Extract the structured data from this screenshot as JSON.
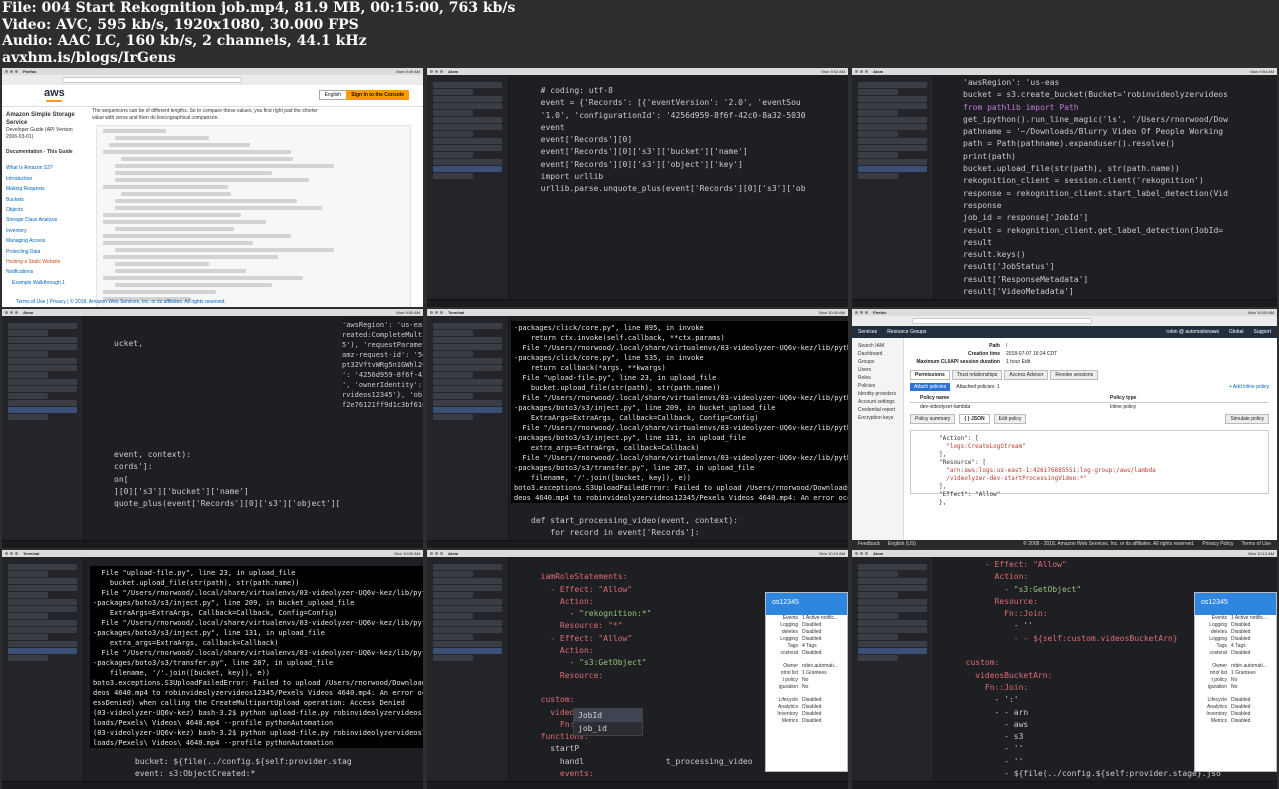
{
  "meta": {
    "file": "File: 004 Start Rekognition job.mp4, 81.9 MB, 00:15:00, 763 kb/s",
    "video": "Video: AVC, 595 kb/s, 1920x1080, 30.000 FPS",
    "audio": "Audio: AAC LC, 160 kb/s, 2 channels, 44.1 kHz",
    "site": "avxhm.is/blogs/IrGens"
  },
  "tile1": {
    "app": "Firefox",
    "clock": "Mon 9:49 AM",
    "docs": {
      "console_button": "Sign In to the Console",
      "language": "English",
      "service_title": "Amazon Simple Storage Service",
      "guide": "Developer Guide (API Version 2006-03-01)",
      "doc_title": "Documentation - This Guide",
      "nav": [
        "What Is Amazon S3?",
        "Introduction",
        "Making Requests",
        "Buckets",
        "Objects",
        "Storage Class Analysis",
        "Inventory",
        "Managing Access",
        "Protecting Data",
        "Hosting a Static Website",
        "Notifications"
      ],
      "nav_active": "Hosting a Static Website",
      "nav_sub": "Example Walkthrough 1",
      "body_line_1": "The sequencers can be of different lengths. So to compare these values, you first right pad the shorter",
      "body_line_2": "value with zeros and then do lexicographical comparison.",
      "footer": "Terms of Use | Privacy | © 2018, Amazon Web Services, Inc. or its affiliates. All rights reserved."
    }
  },
  "tile2": {
    "app": "Atom",
    "clock": "Mon 9:52 AM",
    "code": [
      "  # coding: utf-8",
      "  event = {'Records': [{'eventVersion': '2.0', 'eventSou",
      "  '1.0', 'configurationId': '4256d959-8f6f-42c0-8a32-5030",
      "  event",
      "  event['Records'][0]",
      "  event['Records'][0]['s3']['bucket']['name']",
      "  event['Records'][0]['s3']['object']['key']",
      "  import urllib",
      "  urllib.parse.unquote_plus(event['Records'][0]['s3']['ob"
    ]
  },
  "tile3": {
    "app": "Atom",
    "clock": "Mon 9:54 AM",
    "code": [
      "'awsRegion': 'us-eas",
      "bucket = s3.create_bucket(Bucket='robinvideolyzervideos",
      "from pathlib import Path",
      "get_ipython().run_line_magic('ls', '/Users/rnorwood/Dow",
      "pathname = '~/Downloads/Blurry Video Of People Working",
      "path = Path(pathname).expanduser().resolve()",
      "print(path)",
      "bucket.upload_file(str(path), str(path.name))",
      "rekognition_client = session.client('rekognition')",
      "response = rekognition_client.start_label_detection(Vid",
      "response",
      "job_id = response['JobId']",
      "result = rekognition_client.get_label_detection(JobId=",
      "result",
      "result.keys()",
      "result['JobStatus']",
      "result['ResponseMetadata']",
      "result['VideoMetadata']",
      "result['Labels']",
      "len(result['Labels'])"
    ]
  },
  "tile4": {
    "app": "Atom",
    "clock": "Mon 9:55 AM",
    "code": [
      "",
      "ucket,",
      "",
      "",
      "",
      "",
      "",
      "",
      "",
      "",
      "event, context):",
      "cords']:",
      "on[",
      "][0]['s3']['bucket']['name']",
      "quote_plus(event['Records'][0]['s3']['object']['key'])"
    ],
    "overlay": [
      "'awsRegion': 'us-eas",
      "reated:CompleteMultipa",
      "5'), 'requestParameter",
      "amz-request-id': '5C55",
      "pt32VftvWRg5n1GWhl2C",
      "': '4256d959-8f6f-42",
      "', 'ownerIdentity': {",
      "rvideos12345'}, 'objec",
      "f2e76121ff9d1c3bf616c4"
    ]
  },
  "tile5": {
    "app": "Terminal",
    "clock": "Mon 10:00 AM",
    "term": [
      "-packages/click/core.py\", line 895, in invoke",
      "    return ctx.invoke(self.callback, **ctx.params)",
      "  File \"/Users/rnorwood/.local/share/virtualenvs/03-videolyzer-UQ6v-kez/lib/python3.6/site",
      "-packages/click/core.py\", line 535, in invoke",
      "    return callback(*args, **kwargs)",
      "  File \"upload-file.py\", line 23, in upload_file",
      "    bucket.upload_file(str(path), str(path.name))",
      "  File \"/Users/rnorwood/.local/share/virtualenvs/03-videolyzer-UQ6v-kez/lib/python3.6/site",
      "-packages/boto3/s3/inject.py\", line 209, in bucket_upload_file",
      "    ExtraArgs=ExtraArgs, Callback=Callback, Config=Config)",
      "  File \"/Users/rnorwood/.local/share/virtualenvs/03-videolyzer-UQ6v-kez/lib/python3.6/site",
      "-packages/boto3/s3/inject.py\", line 131, in upload_file",
      "    extra_args=ExtraArgs, callback=Callback)",
      "  File \"/Users/rnorwood/.local/share/virtualenvs/03-videolyzer-UQ6v-kez/lib/python3.6/site",
      "-packages/boto3/s3/transfer.py\", line 287, in upload_file",
      "    filename, '/'.join([bucket, key]), e))",
      "boto3.exceptions.S3UploadFailedError: Failed to upload /Users/rnorwood/Downloads/Pexels Vi",
      "deos 4640.mp4 to robinvideolyzervideos12345/Pexels Videos 4640.mp4: An error occurred (Acc",
      "essDenied) when calling the CreateMultipartUpload operation: Access Denied",
      "(03-videolyzer-UQ6v-kez) bash-3.2$ python upload-file.py robinvideolyzervideos12345 ~/Down",
      "loads/Pexels\\ Videos\\ 4640.mp4 --profile pythonAutomation"
    ],
    "code": [
      "def start_processing_video(event, context):",
      "    for record in event['Records']:"
    ]
  },
  "tile6": {
    "app": "Firefox",
    "clock": "Mon 10:03 AM",
    "services": "Services",
    "resource_groups": "Resource Groups",
    "user": "robin @ automationaws",
    "region": "Global",
    "support": "Support",
    "nav": [
      "Search IAM",
      "Dashboard",
      "Groups",
      "Users",
      "Roles",
      "Policies",
      "Identity providers",
      "Account settings",
      "Credential report",
      "Encryption keys"
    ],
    "summary": [
      {
        "k": "Path",
        "v": "/"
      },
      {
        "k": "Creation time",
        "v": "2018-07-07 16:24 CDT"
      },
      {
        "k": "Maximum CLI/API session duration",
        "v": "1 hour Edit"
      }
    ],
    "tabs": [
      "Permissions",
      "Trust relationships",
      "Access Advisor",
      "Revoke sessions"
    ],
    "attach": "Attach policies",
    "attached_count": "Attached policies: 1",
    "add_inline": "+ Add inline policy",
    "col_policy": "Policy name",
    "col_type": "Policy type",
    "policy_row": "dev-videolyzer-lambda",
    "policy_type": "Inline policy",
    "policy_summary": "Policy summary",
    "json_tab": "{ } JSON",
    "edit_policy": "Edit policy",
    "simulate": "Simulate policy",
    "json": [
      "\"Action\": [",
      "  \"logs:CreateLogStream\"",
      "],",
      "\"Resource\": [",
      "  \"arn:aws:logs:us-east-1:426176885551:log-group:/aws/lambda",
      "  /videolyzer-dev-startProcessingVideo:*\"",
      "],",
      "\"Effect\": \"Allow\"",
      "},"
    ],
    "feedback": "Feedback",
    "language": "English (US)",
    "copyright": "© 2008 - 2018, Amazon Web Services, Inc. or its affiliates. All rights reserved.",
    "privacy": "Privacy Policy",
    "terms": "Terms of Use"
  },
  "tile7": {
    "app": "Terminal",
    "clock": "Mon 10:05 AM",
    "term": [
      "  File \"upload-file.py\", line 23, in upload_file",
      "    bucket.upload_file(str(path), str(path.name))",
      "  File \"/Users/rnorwood/.local/share/virtualenvs/03-videolyzer-UQ6v-kez/lib/python3.6/site",
      "-packages/boto3/s3/inject.py\", line 209, in bucket_upload_file",
      "    ExtraArgs=ExtraArgs, Callback=Callback, Config=Config)",
      "  File \"/Users/rnorwood/.local/share/virtualenvs/03-videolyzer-UQ6v-kez/lib/python3.6/site",
      "-packages/boto3/s3/inject.py\", line 131, in upload_file",
      "    extra_args=ExtraArgs, callback=Callback)",
      "  File \"/Users/rnorwood/.local/share/virtualenvs/03-videolyzer-UQ6v-kez/lib/python3.6/site",
      "-packages/boto3/s3/transfer.py\", line 287, in upload_file",
      "    filename, '/'.join([bucket, key]), e))",
      "boto3.exceptions.S3UploadFailedError: Failed to upload /Users/rnorwood/Downloads/Pexels Vi",
      "deos 4640.mp4 to robinvideolyzervideos12345/Pexels Videos 4640.mp4: An error occurred (Acc",
      "essDenied) when calling the CreateMultipartUpload operation: Access Denied",
      "(03-videolyzer-UQ6v-kez) bash-3.2$ python upload-file.py robinvideolyzervideos12345 ~/Down",
      "loads/Pexels\\ Videos\\ 4640.mp4 --profile pythonAutomation",
      "(03-videolyzer-UQ6v-kez) bash-3.2$ python upload-file.py robinvideolyzervideos12345 ~/Down",
      "loads/Pexels\\ Videos\\ 4640.mp4 --profile pythonAutomation"
    ],
    "code": [
      "      bucket: ${file(../config.${self:provider.stag",
      "      event: s3:ObjectCreated:*"
    ]
  },
  "tile8": {
    "app": "Atom",
    "clock": "Mon 10:10 AM",
    "code": [
      "",
      "  iamRoleStatements:",
      "    - Effect: \"Allow\"",
      "      Action:",
      "        - \"rekognition:*\"",
      "      Resource: \"*\"",
      "    - Effect: \"Allow\"",
      "      Action:",
      "        - \"s3:GetObject\"",
      "      Resource:",
      "",
      "  custom:",
      "    videosBucketArn:",
      "      Fn::Join:",
      "  functions:",
      "    startP",
      "      handl                 t_processing_video",
      "      events:",
      "        - s3:",
      "            bucket: ${file(../config.${self:provider.stag",
      "            event: s3:ObjectCreated:*"
    ],
    "autocomplete": [
      "JobId",
      "job_id"
    ],
    "panel_title": "os12345",
    "panel_rows": [
      {
        "k": "Events",
        "v": "1 Active notific..."
      },
      {
        "k": "Logging",
        "v": "Disabled"
      },
      {
        "k": "deletes",
        "v": "Disabled"
      },
      {
        "k": "Logging",
        "v": "Disabled"
      },
      {
        "k": "Tags",
        "v": "4 Tags"
      },
      {
        "k": "ccelerat",
        "v": "Disabled"
      },
      {
        "k": "",
        "v": ""
      },
      {
        "k": "Owner",
        "v": "robin.automati..."
      },
      {
        "k": "ntrol list",
        "v": "1 Grantees"
      },
      {
        "k": "t policy",
        "v": "No"
      },
      {
        "k": "iguration",
        "v": "No"
      },
      {
        "k": "",
        "v": ""
      },
      {
        "k": "Lifecycle",
        "v": "Disabled"
      },
      {
        "k": "Analytics",
        "v": "Disabled"
      },
      {
        "k": "Inventory",
        "v": "Disabled"
      },
      {
        "k": "Metrics",
        "v": "Disabled"
      }
    ]
  },
  "tile9": {
    "app": "Atom",
    "clock": "Mon 10:13 AM",
    "code": [
      "      - Effect: \"Allow\"",
      "        Action:",
      "          - \"s3:GetObject\"",
      "        Resource:",
      "          Fn::Join:",
      "            - ''",
      "            - - ${self:custom.videosBucketArn}",
      "",
      "  custom:",
      "    videosBucketArn:",
      "      Fn::Join:",
      "        - ':'",
      "        - - arn",
      "          - aws",
      "          - s3",
      "          - ''",
      "          - ''",
      "          - ${file(../config.${self:provider.stage}.jso",
      "",
      "  functions:"
    ],
    "panel_title": "os12345",
    "panel_rows": [
      {
        "k": "Events",
        "v": "1 Active notific..."
      },
      {
        "k": "Logging",
        "v": "Disabled"
      },
      {
        "k": "deletes",
        "v": "Disabled"
      },
      {
        "k": "Logging",
        "v": "Disabled"
      },
      {
        "k": "Tags",
        "v": "4 Tags"
      },
      {
        "k": "ccelerat",
        "v": "Disabled"
      },
      {
        "k": "",
        "v": ""
      },
      {
        "k": "Owner",
        "v": "robin.automati..."
      },
      {
        "k": "ntrol list",
        "v": "1 Grantees"
      },
      {
        "k": "t policy",
        "v": "No"
      },
      {
        "k": "iguration",
        "v": "No"
      },
      {
        "k": "",
        "v": ""
      },
      {
        "k": "Lifecycle",
        "v": "Disabled"
      },
      {
        "k": "Analytics",
        "v": "Disabled"
      },
      {
        "k": "Inventory",
        "v": "Disabled"
      },
      {
        "k": "Metrics",
        "v": "Disabled"
      }
    ]
  }
}
